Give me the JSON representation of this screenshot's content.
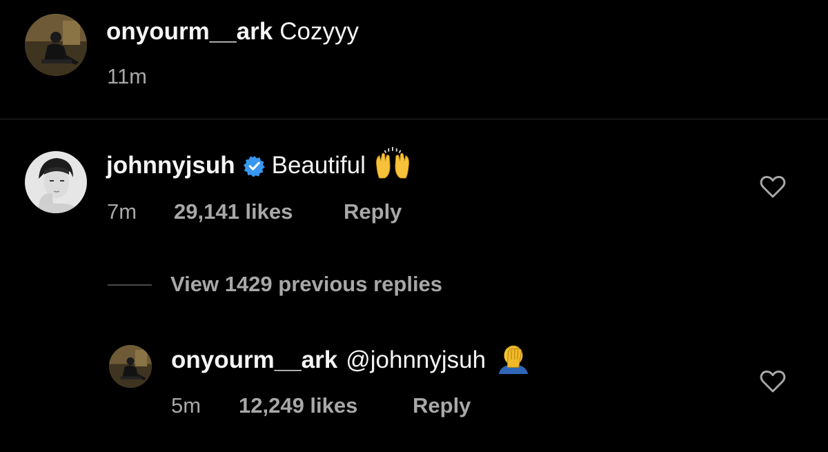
{
  "comments": [
    {
      "username": "onyourm__ark",
      "text": "Cozyyy",
      "time": "11m"
    },
    {
      "username": "johnnyjsuh",
      "text": "Beautiful",
      "emoji": "raising-hands",
      "time": "7m",
      "likes": "29,141 likes",
      "reply_label": "Reply",
      "verified": true
    }
  ],
  "view_replies": "View 1429 previous replies",
  "reply": {
    "username": "onyourm__ark",
    "text": "@johnnyjsuh",
    "emoji": "face-palm",
    "time": "5m",
    "likes": "12,249 likes",
    "reply_label": "Reply"
  },
  "colors": {
    "background": "#000000",
    "text": "#f5f5f5",
    "muted": "#a8a8a8",
    "verified": "#3897f0",
    "divider": "#262626"
  }
}
